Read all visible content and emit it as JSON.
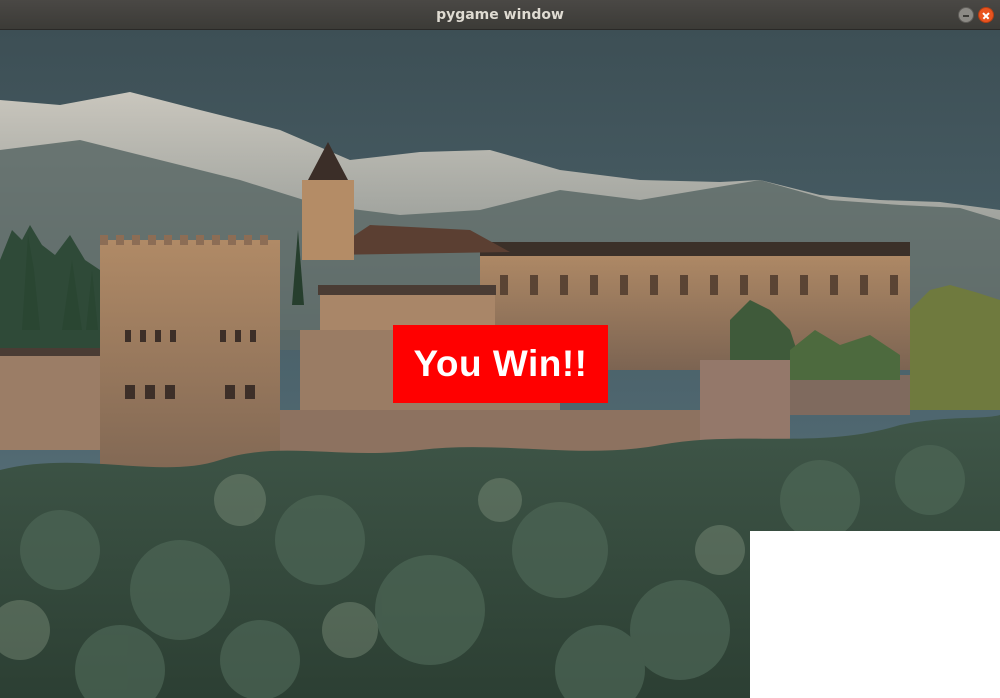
{
  "window": {
    "title": "pygame window",
    "controls": [
      "minimize-icon",
      "close-icon"
    ],
    "close_color": "#e95420"
  },
  "game": {
    "message": "You Win!!",
    "message_bg_color": "#ff0000",
    "message_text_color": "#ffffff",
    "panel_color": "#ffffff",
    "background_scene": "Alhambra palace with snowy mountains"
  }
}
